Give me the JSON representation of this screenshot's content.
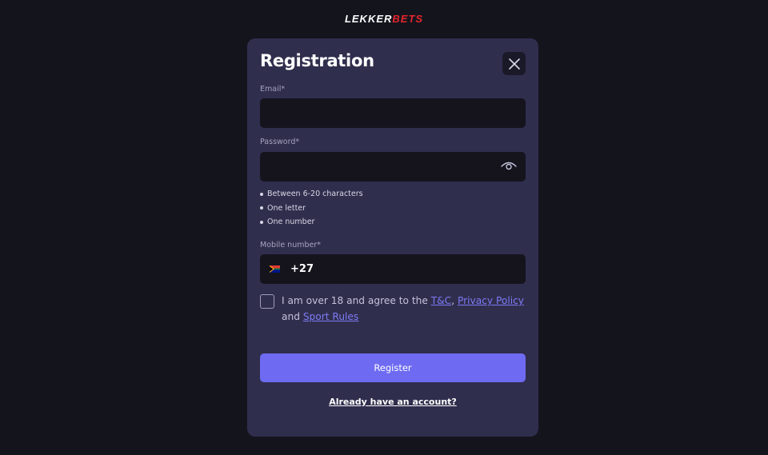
{
  "brand": {
    "logo_part1": "LEKKER",
    "logo_part2": "BETS",
    "logo_color_primary": "#ffffff",
    "logo_color_accent": "#e5262d"
  },
  "modal": {
    "title": "Registration",
    "close_icon": "close-icon",
    "background": "#302e4d"
  },
  "form": {
    "email": {
      "label": "Email*",
      "value": "",
      "placeholder": ""
    },
    "password": {
      "label": "Password*",
      "value": "",
      "placeholder": "",
      "toggle_icon": "eye-icon",
      "rules": [
        "Between 6-20 characters",
        "One letter",
        "One number"
      ]
    },
    "mobile": {
      "label": "Mobile number*",
      "flag_icon": "south-africa-flag-icon",
      "prefix": "+27",
      "value": "",
      "placeholder": ""
    },
    "agreement": {
      "checked": false,
      "text_before": "I am over 18 and agree to the ",
      "link_tc": "T&C",
      "sep1": ", ",
      "link_privacy": "Privacy Policy",
      "sep2": " and ",
      "link_sport_rules": "Sport Rules",
      "link_color": "#7d7bf5"
    },
    "register_button": {
      "label": "Register",
      "color": "#6e6bf2"
    },
    "login_link": "Already have an account?"
  }
}
